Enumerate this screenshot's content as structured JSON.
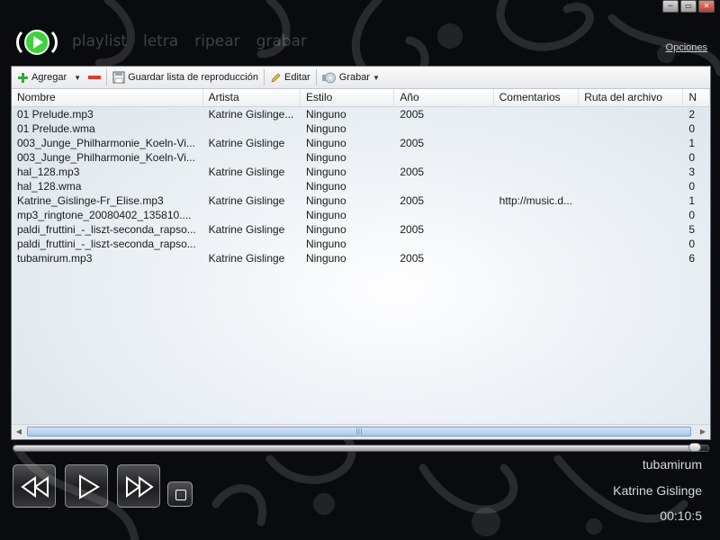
{
  "header": {
    "nav": [
      "playlist",
      "letra",
      "ripear",
      "grabar"
    ],
    "options_link": "Opciones"
  },
  "window_controls": [
    "─",
    "▭",
    "✕"
  ],
  "toolbar": {
    "add_label": "Agregar",
    "save_playlist_label": "Guardar lista de reproducción",
    "edit_label": "Editar",
    "burn_label": "Grabar"
  },
  "table": {
    "columns": [
      "Nombre",
      "Artista",
      "Estilo",
      "Año",
      "Comentarios",
      "Ruta del archivo",
      "N"
    ],
    "rows": [
      [
        "01 Prelude.mp3",
        "Katrine Gislinge...",
        "Ninguno",
        "2005",
        "",
        "",
        "2"
      ],
      [
        "01 Prelude.wma",
        "",
        "Ninguno",
        "",
        "",
        "",
        "0"
      ],
      [
        "003_Junge_Philharmonie_Koeln-Vi...",
        "Katrine Gislinge",
        "Ninguno",
        "2005",
        "",
        "",
        "1"
      ],
      [
        "003_Junge_Philharmonie_Koeln-Vi...",
        "",
        "Ninguno",
        "",
        "",
        "",
        "0"
      ],
      [
        "hal_128.mp3",
        "Katrine Gislinge",
        "Ninguno",
        "2005",
        "",
        "",
        "3"
      ],
      [
        "hal_128.wma",
        "",
        "Ninguno",
        "",
        "",
        "",
        "0"
      ],
      [
        "Katrine_Gislinge-Fr_Elise.mp3",
        "Katrine Gislinge",
        "Ninguno",
        "2005",
        "http://music.d...",
        "",
        "1"
      ],
      [
        "mp3_ringtone_20080402_135810....",
        "",
        "Ninguno",
        "",
        "",
        "",
        "0"
      ],
      [
        "paldi_fruttini_-_liszt-seconda_rapso...",
        "Katrine Gislinge",
        "Ninguno",
        "2005",
        "",
        "",
        "5"
      ],
      [
        "paldi_fruttini_-_liszt-seconda_rapso...",
        "",
        "Ninguno",
        "",
        "",
        "",
        "0"
      ],
      [
        "tubamirum.mp3",
        "Katrine Gislinge",
        "Ninguno",
        "2005",
        "",
        "",
        "6"
      ]
    ]
  },
  "player": {
    "progress": 0.98,
    "track_title": "tubamirum",
    "track_artist": "Katrine Gislinge",
    "elapsed_time": "00:10:5"
  },
  "colors": {
    "background": "#0a0b0e",
    "logo_green": "#3fd23a",
    "scroll_thumb": "#a9c7ec"
  }
}
